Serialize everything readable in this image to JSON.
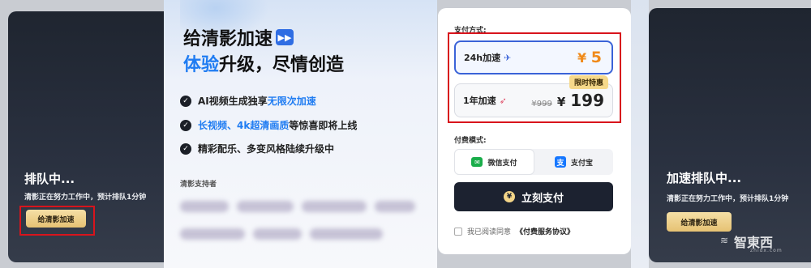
{
  "left": {
    "title": "排队中...",
    "subtitle": "清影正在努力工作中，预计排队1分钟",
    "button": "给清影加速"
  },
  "promo": {
    "headline1": "给清影加速",
    "headline2_blue": "体验",
    "headline2_rest": "升级，尽情创造",
    "features": [
      {
        "pre": "AI视频生成独享",
        "blue": "无限次加速",
        "post": ""
      },
      {
        "pre": "",
        "blue": "长视频、4k超清画质",
        "post": "等惊喜即将上线"
      },
      {
        "pre": "精彩配乐、多变风格陆续升级中",
        "blue": "",
        "post": ""
      }
    ],
    "support_label": "清影支持者"
  },
  "payment": {
    "method_label": "支付方式:",
    "options": [
      {
        "label": "24h加速",
        "icon": "plane-emoji",
        "currency": "¥",
        "price": "5"
      },
      {
        "label": "1年加速",
        "icon": "rocket-emoji",
        "old_price": "¥999",
        "currency": "¥",
        "price": "199",
        "tag": "限时特惠"
      }
    ],
    "mode_label": "付费模式:",
    "methods": [
      {
        "name": "微信支付",
        "icon": "wechat-icon",
        "active": true
      },
      {
        "name": "支付宝",
        "icon": "alipay-icon",
        "active": false
      }
    ],
    "pay_button": "立刻支付",
    "agree_text": "我已阅读同意",
    "agree_link": "《付费服务协议》"
  },
  "right": {
    "title": "加速排队中...",
    "subtitle": "清影正在努力工作中，预计排队1分钟",
    "button": "给清影加速"
  },
  "watermark": {
    "text": "智東西",
    "sub": "zhidx.com"
  },
  "colors": {
    "accent_blue": "#1f7cf2",
    "price_orange": "#f08a1a",
    "highlight_red": "#d8141c",
    "gold": "#e6c273",
    "dark_panel": "#1f2530"
  }
}
